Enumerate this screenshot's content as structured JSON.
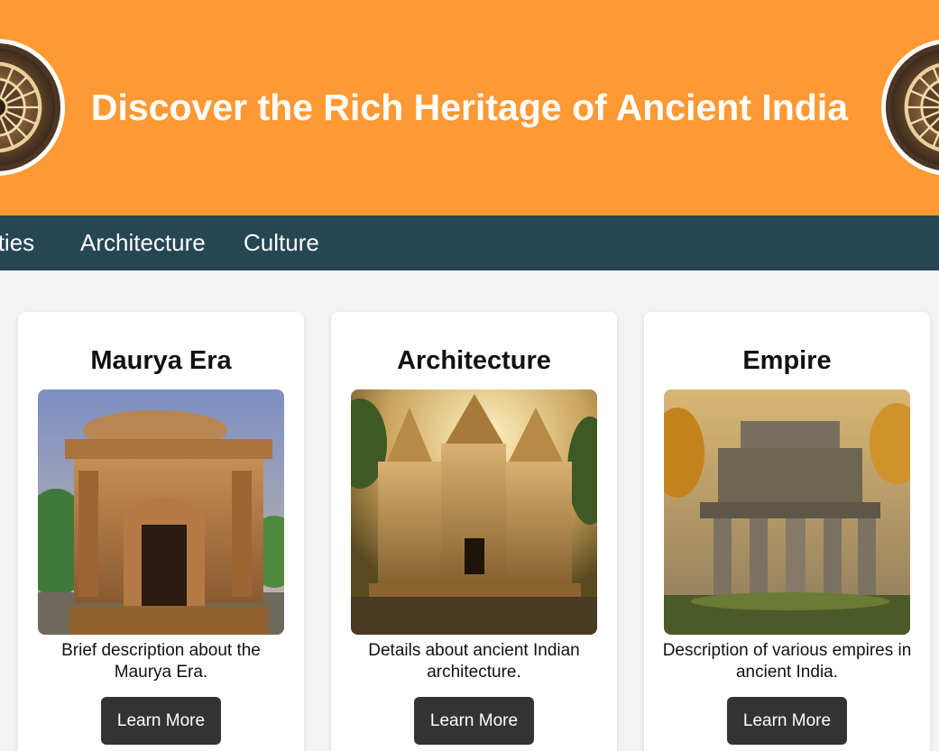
{
  "header": {
    "title": "Discover the Rich Heritage of Ancient India",
    "background_color": "#ff9933",
    "emblem_icon": "wheel-emblem-icon"
  },
  "nav": {
    "background_color": "#264653",
    "items": [
      {
        "label": "Dynasties"
      },
      {
        "label": "Architecture"
      },
      {
        "label": "Culture"
      }
    ]
  },
  "cards": [
    {
      "title": "Maurya Era",
      "image": "ancient-stone-shrine-image",
      "description": "Brief description about the Maurya Era.",
      "button_label": "Learn More"
    },
    {
      "title": "Architecture",
      "image": "golden-temple-towers-image",
      "description": "Details about ancient Indian architecture.",
      "button_label": "Learn More"
    },
    {
      "title": "Empire",
      "image": "columned-ruins-image",
      "description": "Description of various empires in ancient India.",
      "button_label": "Learn More"
    }
  ],
  "colors": {
    "page_background": "#f3f3f3",
    "button_background": "#333333"
  }
}
